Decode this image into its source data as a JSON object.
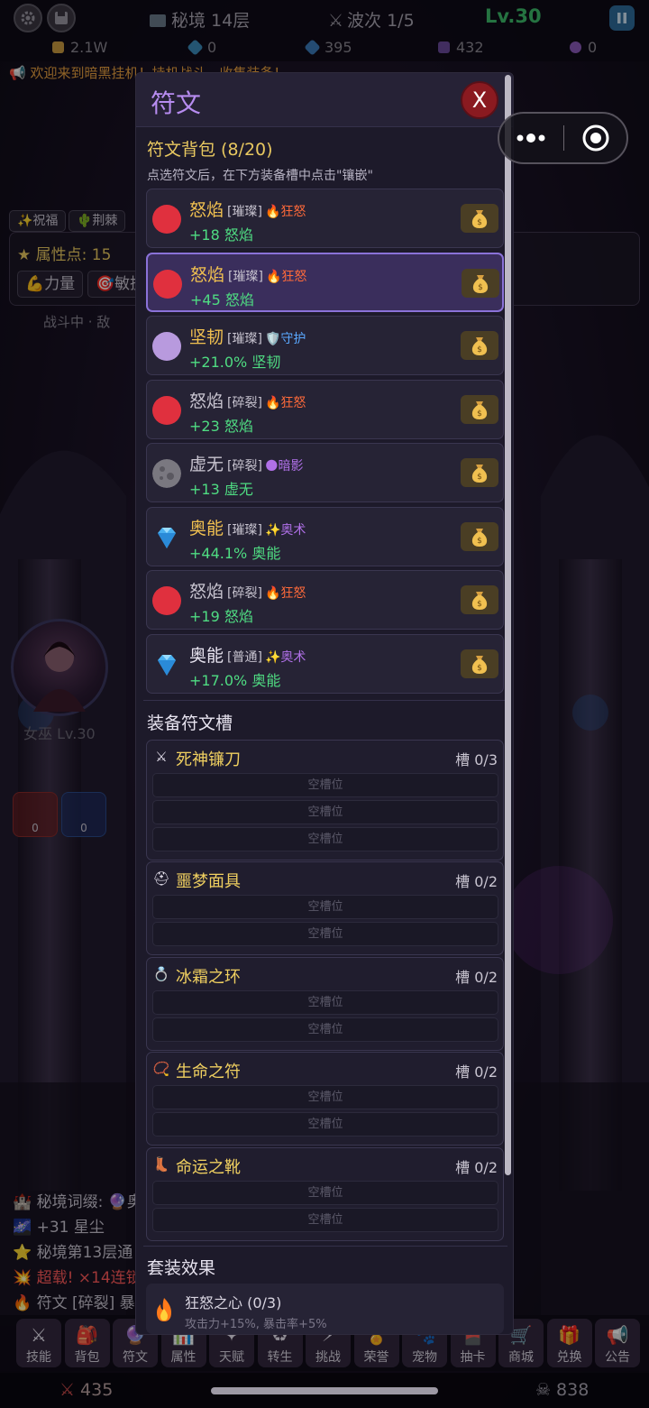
{
  "topbar": {
    "realm_icon": "chest-icon",
    "realm_label": "秘境 14层",
    "wave_icon": "crossed-swords-icon",
    "wave_label": "波次 1/5",
    "level": "Lv.30"
  },
  "resources": [
    {
      "icon": "gold-bag-icon",
      "color": "#c89a40",
      "value": "2.1W"
    },
    {
      "icon": "gem-icon",
      "color": "#3a8ab8",
      "value": "0"
    },
    {
      "icon": "crystal-icon",
      "color": "#3a7ab8",
      "value": "395"
    },
    {
      "icon": "stardust-icon",
      "color": "#6a4a9a",
      "value": "432"
    },
    {
      "icon": "orb-icon",
      "color": "#8a5ab8",
      "value": "0"
    }
  ],
  "ticker": "📢 欢迎来到暗黑挂机！持机战斗，收集装备！",
  "hud": {
    "blessing": "✨祝福",
    "thorns": "🌵荆棘",
    "attr_points": "★ 属性点: 15",
    "strength": "💪力量",
    "agility": "🎯敏捷",
    "battle_status": "战斗中 · 敌",
    "hero_label": "女巫 Lv.30",
    "potion_red": "0",
    "potion_blue": "0"
  },
  "log": [
    "🏰 秘境词缀: 🔮奥",
    "🌌 +31 星尘",
    "⭐ 秘境第13层通",
    "💥 超载! ×14连锁",
    "🔥 符文 [碎裂] 暴"
  ],
  "modal": {
    "title": "符文",
    "close_label": "X",
    "bag_title": "符文背包 (8/20)",
    "hint": "点选符文后，在下方装备槽中点击\"镶嵌\"",
    "runes": [
      {
        "name": "怒焰",
        "tier": "[璀璨]",
        "set": "🔥狂怒",
        "set_color": "#ff6a3a",
        "stat": "+18 怒焰",
        "icon": "red-rune-icon",
        "color": "#e0303e",
        "name_color": "#f0c050",
        "selected": false
      },
      {
        "name": "怒焰",
        "tier": "[璀璨]",
        "set": "🔥狂怒",
        "set_color": "#ff6a3a",
        "stat": "+45 怒焰",
        "icon": "red-rune-icon",
        "color": "#e0303e",
        "name_color": "#f0c050",
        "selected": true
      },
      {
        "name": "坚韧",
        "tier": "[璀璨]",
        "set": "🛡️守护",
        "set_color": "#5aa8ff",
        "stat": "+21.0% 坚韧",
        "icon": "lavender-rune-icon",
        "color": "#b89ade",
        "name_color": "#f0c050",
        "selected": false
      },
      {
        "name": "怒焰",
        "tier": "[碎裂]",
        "set": "🔥狂怒",
        "set_color": "#ff6a3a",
        "stat": "+23 怒焰",
        "icon": "red-rune-icon",
        "color": "#e0303e",
        "name_color": "#c8c4d0",
        "selected": false
      },
      {
        "name": "虚无",
        "tier": "[碎裂]",
        "set": "🌑暗影",
        "set_color": "#b070e8",
        "stat": "+13 虚无",
        "icon": "moon-rune-icon",
        "color": "#7a7880",
        "name_color": "#c8c4d0",
        "selected": false
      },
      {
        "name": "奥能",
        "tier": "[璀璨]",
        "set": "✨奥术",
        "set_color": "#b070e8",
        "stat": "+44.1% 奥能",
        "icon": "diamond-rune-icon",
        "color": "#4ab0f0",
        "name_color": "#f0c050",
        "selected": false
      },
      {
        "name": "怒焰",
        "tier": "[碎裂]",
        "set": "🔥狂怒",
        "set_color": "#ff6a3a",
        "stat": "+19 怒焰",
        "icon": "red-rune-icon",
        "color": "#e0303e",
        "name_color": "#c8c4d0",
        "selected": false
      },
      {
        "name": "奥能",
        "tier": "[普通]",
        "set": "✨奥术",
        "set_color": "#b070e8",
        "stat": "+17.0% 奥能",
        "icon": "diamond-rune-icon",
        "color": "#4ab0f0",
        "name_color": "#e8e4f0",
        "selected": false
      }
    ],
    "sell_icon": "money-bag-icon",
    "equip_title": "装备符文槽",
    "empty_slot_label": "空槽位",
    "equipment": [
      {
        "name": "死神镰刀",
        "icon": "crossed-swords-icon",
        "glyph": "⚔",
        "count": "槽 0/3",
        "slots": 3
      },
      {
        "name": "噩梦面具",
        "icon": "helmet-icon",
        "glyph": "⛑",
        "count": "槽 0/2",
        "slots": 2
      },
      {
        "name": "冰霜之环",
        "icon": "ring-icon",
        "glyph": "💍",
        "count": "槽 0/2",
        "slots": 2
      },
      {
        "name": "生命之符",
        "icon": "amulet-icon",
        "glyph": "📿",
        "count": "槽 0/2",
        "slots": 2
      },
      {
        "name": "命运之靴",
        "icon": "boot-icon",
        "glyph": "👢",
        "count": "槽 0/2",
        "slots": 2
      }
    ],
    "set_title": "套装效果",
    "set_effect": {
      "icon": "fire-icon",
      "name": "狂怒之心 (0/3)",
      "desc": "攻击力+15%, 暴击率+5%"
    }
  },
  "nav": [
    {
      "label": "技能",
      "icon": "swords-icon",
      "glyph": "⚔"
    },
    {
      "label": "背包",
      "icon": "backpack-icon",
      "glyph": "🎒"
    },
    {
      "label": "符文",
      "icon": "rune-icon",
      "glyph": "🔮"
    },
    {
      "label": "属性",
      "icon": "stats-icon",
      "glyph": "📊"
    },
    {
      "label": "天赋",
      "icon": "talent-icon",
      "glyph": "✦"
    },
    {
      "label": "转生",
      "icon": "rebirth-icon",
      "glyph": "♻"
    },
    {
      "label": "挑战",
      "icon": "challenge-icon",
      "glyph": "⚡"
    },
    {
      "label": "荣誉",
      "icon": "honor-icon",
      "glyph": "🏅"
    },
    {
      "label": "宠物",
      "icon": "pet-icon",
      "glyph": "🐾"
    },
    {
      "label": "抽卡",
      "icon": "gacha-icon",
      "glyph": "🎴"
    },
    {
      "label": "商城",
      "icon": "shop-icon",
      "glyph": "🛒"
    },
    {
      "label": "兑换",
      "icon": "gift-icon",
      "glyph": "🎁"
    },
    {
      "label": "公告",
      "icon": "megaphone-icon",
      "glyph": "📢"
    }
  ],
  "stats": {
    "attack": "435",
    "kills": "838"
  }
}
